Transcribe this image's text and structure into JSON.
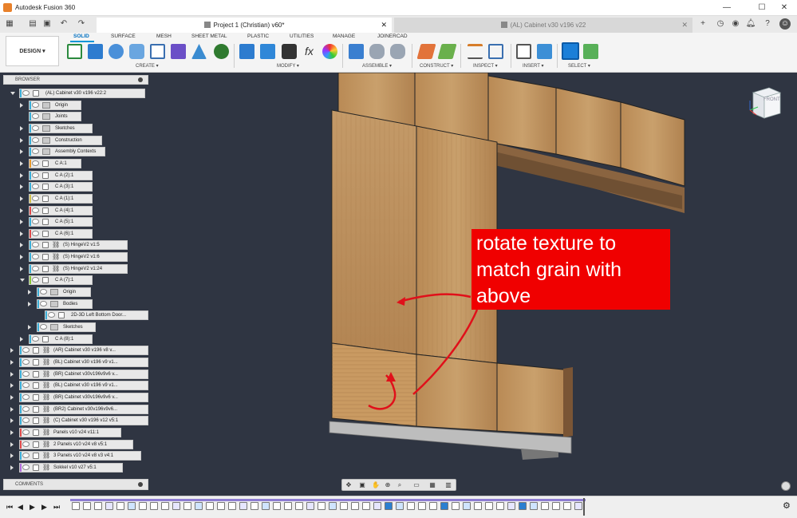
{
  "app": {
    "title": "Autodesk Fusion 360"
  },
  "tabs": [
    {
      "label": "Project 1 (Christian) v60*",
      "active": true
    },
    {
      "label": "(AL) Cabinet v30 v196 v22",
      "active": false
    }
  ],
  "workspace": {
    "label": "DESIGN"
  },
  "toolbar_tabs": [
    "SOLID",
    "SURFACE",
    "MESH",
    "SHEET METAL",
    "PLASTIC",
    "UTILITIES",
    "MANAGE",
    "JOINERCAD"
  ],
  "groups": [
    "CREATE",
    "MODIFY",
    "ASSEMBLE",
    "CONSTRUCT",
    "INSPECT",
    "INSERT",
    "SELECT"
  ],
  "browser": {
    "title": "BROWSER",
    "items": [
      {
        "label": "(AL) Cabinet v30 v196 v22:2"
      },
      {
        "label": "Origin"
      },
      {
        "label": "Joints"
      },
      {
        "label": "Sketches"
      },
      {
        "label": "Construction"
      },
      {
        "label": "Assembly Contexts"
      },
      {
        "label": "C A:1"
      },
      {
        "label": "C A (2):1"
      },
      {
        "label": "C A (3):1"
      },
      {
        "label": "C A (1):1"
      },
      {
        "label": "C A (4):1"
      },
      {
        "label": "C A (5):1"
      },
      {
        "label": "C A (6):1"
      },
      {
        "label": "(S) HingeV2 v1:5"
      },
      {
        "label": "(S) HingeV2 v1:6"
      },
      {
        "label": "(S) HingeV2 v1:24"
      },
      {
        "label": "C A (7):1"
      },
      {
        "label": "Origin"
      },
      {
        "label": "Bodies"
      },
      {
        "label": "2D-3D Left Bottom Door..."
      },
      {
        "label": "Sketches"
      },
      {
        "label": "C A (8):1"
      },
      {
        "label": "(AR) Cabinet v30 v196 v8 v..."
      },
      {
        "label": "(BL) Cabinet v30 v196 v9 v1..."
      },
      {
        "label": "(BR) Cabinet v30v196v9v6 v..."
      },
      {
        "label": "(BL) Cabinet v30 v196 v9 v1..."
      },
      {
        "label": "(BR) Cabinet v30v196v9v6 v..."
      },
      {
        "label": "(BR2) Cabinet v30v196v9v6..."
      },
      {
        "label": "(C) Cabinet v30 v196 v12 v5:1"
      },
      {
        "label": "Panels v10 v24 v11:1"
      },
      {
        "label": "2 Panels v10 v24 v8 v5:1"
      },
      {
        "label": "3 Panels v10 v24 v8 v3 v4:1"
      },
      {
        "label": "Sokkel v10 v27 v5:1"
      }
    ]
  },
  "comments": {
    "title": "COMMENTS"
  },
  "annotation": {
    "text": "rotate texture to match grain with above"
  },
  "viewcube": {
    "label": "FRONT"
  }
}
